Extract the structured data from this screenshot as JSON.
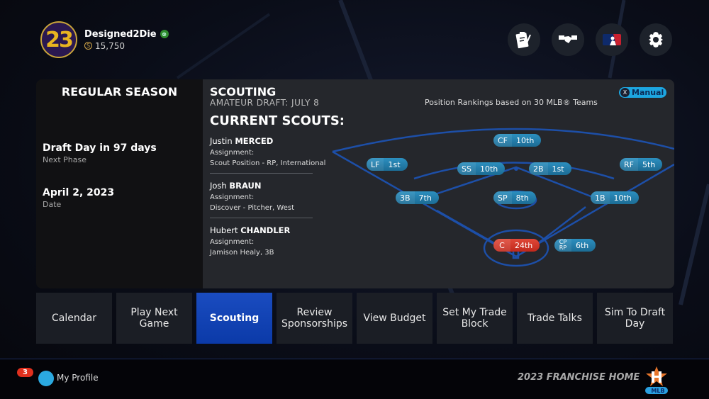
{
  "profile": {
    "avatar_number": "23",
    "username": "Designed2Die",
    "platform_icon": "xbox-icon",
    "coins": "15,750",
    "coin_icon": "stubs-icon"
  },
  "top_icons": [
    {
      "name": "clipboard-icon"
    },
    {
      "name": "handshake-icon"
    },
    {
      "name": "mlb-logo-icon"
    },
    {
      "name": "settings-gear-icon"
    }
  ],
  "season": {
    "title": "REGULAR SEASON",
    "next_phase_main": "Draft Day in 97 days",
    "next_phase_label": "Next Phase",
    "date_main": "April 2, 2023",
    "date_label": "Date"
  },
  "scouting": {
    "title": "SCOUTING",
    "subtitle": "AMATEUR DRAFT: JULY 8",
    "current_scouts_label": "CURRENT SCOUTS:",
    "rank_note": "Position Rankings based on 30 MLB® Teams",
    "toggle": {
      "button": "X",
      "label": "Manual"
    },
    "scouts": [
      {
        "first": "Justin",
        "last": "MERCED",
        "assignment_label": "Assignment:",
        "assignment": "Scout Position - RP, International"
      },
      {
        "first": "Josh",
        "last": "BRAUN",
        "assignment_label": "Assignment:",
        "assignment": "Discover - Pitcher, West"
      },
      {
        "first": "Hubert",
        "last": "CHANDLER",
        "assignment_label": "Assignment:",
        "assignment": "Jamison Healy, 3B"
      }
    ],
    "positions": {
      "CF": "10th",
      "LF": "1st",
      "SS": "10th",
      "2B": "1st",
      "RF": "5th",
      "3B": "7th",
      "SP": "8th",
      "1B": "10th",
      "C": "24th",
      "CP_top": "CP",
      "CP_bottom": "RP",
      "CPRP": "6th"
    },
    "colors": {
      "rank_good": "#1f7fb0",
      "rank_bad": "#d43a2a",
      "field_line": "#1d4fa8"
    }
  },
  "nav": [
    {
      "label": "Calendar",
      "active": false
    },
    {
      "label": "Play Next Game",
      "active": false
    },
    {
      "label": "Scouting",
      "active": true
    },
    {
      "label": "Review Sponsorships",
      "active": false
    },
    {
      "label": "View Budget",
      "active": false
    },
    {
      "label": "Set My Trade Block",
      "active": false
    },
    {
      "label": "Trade Talks",
      "active": false
    },
    {
      "label": "Sim To Draft Day",
      "active": false
    }
  ],
  "footer": {
    "notification_count": "3",
    "profile_label": "My Profile",
    "franchise_label": "2023 FRANCHISE HOME",
    "team_logo": "astros-logo-icon",
    "mlb_badge": "MLB"
  }
}
